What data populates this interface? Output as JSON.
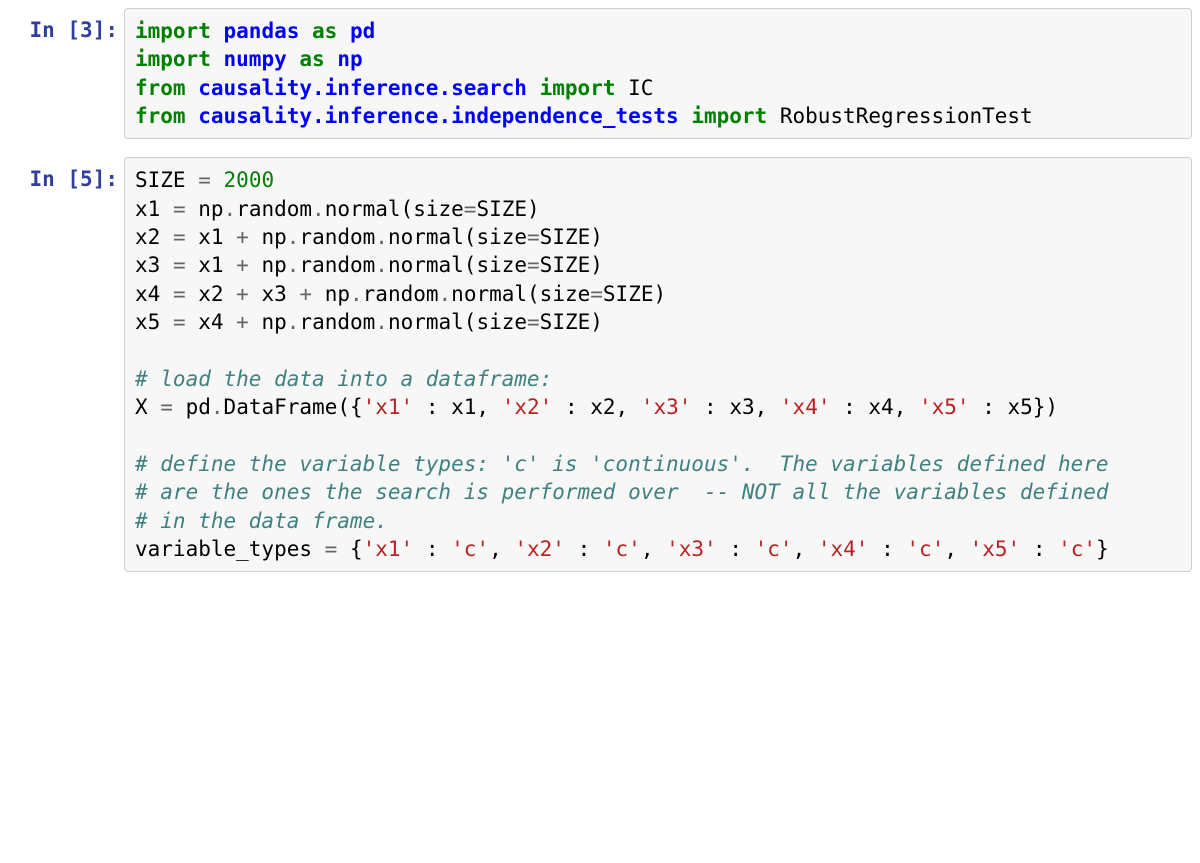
{
  "cells": [
    {
      "prompt": "In [3]:",
      "tokens": [
        {
          "t": "import",
          "c": "kw-green"
        },
        {
          "t": " "
        },
        {
          "t": "pandas",
          "c": "kw-blue"
        },
        {
          "t": " "
        },
        {
          "t": "as",
          "c": "kw-green"
        },
        {
          "t": " "
        },
        {
          "t": "pd",
          "c": "kw-blue"
        },
        {
          "t": "\n"
        },
        {
          "t": "import",
          "c": "kw-green"
        },
        {
          "t": " "
        },
        {
          "t": "numpy",
          "c": "kw-blue"
        },
        {
          "t": " "
        },
        {
          "t": "as",
          "c": "kw-green"
        },
        {
          "t": " "
        },
        {
          "t": "np",
          "c": "kw-blue"
        },
        {
          "t": "\n"
        },
        {
          "t": "from",
          "c": "kw-green"
        },
        {
          "t": " "
        },
        {
          "t": "causality.inference.search",
          "c": "kw-blue"
        },
        {
          "t": " "
        },
        {
          "t": "import",
          "c": "kw-green"
        },
        {
          "t": " IC\n"
        },
        {
          "t": "from",
          "c": "kw-green"
        },
        {
          "t": " "
        },
        {
          "t": "causality.inference.independence_tests",
          "c": "kw-blue"
        },
        {
          "t": " "
        },
        {
          "t": "import",
          "c": "kw-green"
        },
        {
          "t": " RobustRegressionTest"
        }
      ]
    },
    {
      "prompt": "In [5]:",
      "tokens": [
        {
          "t": "SIZE "
        },
        {
          "t": "=",
          "c": "op"
        },
        {
          "t": " "
        },
        {
          "t": "2000",
          "c": "num"
        },
        {
          "t": "\n"
        },
        {
          "t": "x1 "
        },
        {
          "t": "=",
          "c": "op"
        },
        {
          "t": " np"
        },
        {
          "t": ".",
          "c": "op"
        },
        {
          "t": "random"
        },
        {
          "t": ".",
          "c": "op"
        },
        {
          "t": "normal(size"
        },
        {
          "t": "=",
          "c": "op"
        },
        {
          "t": "SIZE)\n"
        },
        {
          "t": "x2 "
        },
        {
          "t": "=",
          "c": "op"
        },
        {
          "t": " x1 "
        },
        {
          "t": "+",
          "c": "op"
        },
        {
          "t": " np"
        },
        {
          "t": ".",
          "c": "op"
        },
        {
          "t": "random"
        },
        {
          "t": ".",
          "c": "op"
        },
        {
          "t": "normal(size"
        },
        {
          "t": "=",
          "c": "op"
        },
        {
          "t": "SIZE)\n"
        },
        {
          "t": "x3 "
        },
        {
          "t": "=",
          "c": "op"
        },
        {
          "t": " x1 "
        },
        {
          "t": "+",
          "c": "op"
        },
        {
          "t": " np"
        },
        {
          "t": ".",
          "c": "op"
        },
        {
          "t": "random"
        },
        {
          "t": ".",
          "c": "op"
        },
        {
          "t": "normal(size"
        },
        {
          "t": "=",
          "c": "op"
        },
        {
          "t": "SIZE)\n"
        },
        {
          "t": "x4 "
        },
        {
          "t": "=",
          "c": "op"
        },
        {
          "t": " x2 "
        },
        {
          "t": "+",
          "c": "op"
        },
        {
          "t": " x3 "
        },
        {
          "t": "+",
          "c": "op"
        },
        {
          "t": " np"
        },
        {
          "t": ".",
          "c": "op"
        },
        {
          "t": "random"
        },
        {
          "t": ".",
          "c": "op"
        },
        {
          "t": "normal(size"
        },
        {
          "t": "=",
          "c": "op"
        },
        {
          "t": "SIZE)\n"
        },
        {
          "t": "x5 "
        },
        {
          "t": "=",
          "c": "op"
        },
        {
          "t": " x4 "
        },
        {
          "t": "+",
          "c": "op"
        },
        {
          "t": " np"
        },
        {
          "t": ".",
          "c": "op"
        },
        {
          "t": "random"
        },
        {
          "t": ".",
          "c": "op"
        },
        {
          "t": "normal(size"
        },
        {
          "t": "=",
          "c": "op"
        },
        {
          "t": "SIZE)\n"
        },
        {
          "t": "\n"
        },
        {
          "t": "# load the data into a dataframe:",
          "c": "comment"
        },
        {
          "t": "\n"
        },
        {
          "t": "X "
        },
        {
          "t": "=",
          "c": "op"
        },
        {
          "t": " pd"
        },
        {
          "t": ".",
          "c": "op"
        },
        {
          "t": "DataFrame({"
        },
        {
          "t": "'x1'",
          "c": "str"
        },
        {
          "t": " : x1, "
        },
        {
          "t": "'x2'",
          "c": "str"
        },
        {
          "t": " : x2, "
        },
        {
          "t": "'x3'",
          "c": "str"
        },
        {
          "t": " : x3, "
        },
        {
          "t": "'x4'",
          "c": "str"
        },
        {
          "t": " : x4, "
        },
        {
          "t": "'x5'",
          "c": "str"
        },
        {
          "t": " : x5})\n"
        },
        {
          "t": "\n"
        },
        {
          "t": "# define the variable types: 'c' is 'continuous'.  The variables defined here",
          "c": "comment"
        },
        {
          "t": "\n"
        },
        {
          "t": "# are the ones the search is performed over  -- NOT all the variables defined",
          "c": "comment"
        },
        {
          "t": "\n"
        },
        {
          "t": "# in the data frame.",
          "c": "comment"
        },
        {
          "t": "\n"
        },
        {
          "t": "variable_types "
        },
        {
          "t": "=",
          "c": "op"
        },
        {
          "t": " {"
        },
        {
          "t": "'x1'",
          "c": "str"
        },
        {
          "t": " : "
        },
        {
          "t": "'c'",
          "c": "str"
        },
        {
          "t": ", "
        },
        {
          "t": "'x2'",
          "c": "str"
        },
        {
          "t": " : "
        },
        {
          "t": "'c'",
          "c": "str"
        },
        {
          "t": ", "
        },
        {
          "t": "'x3'",
          "c": "str"
        },
        {
          "t": " : "
        },
        {
          "t": "'c'",
          "c": "str"
        },
        {
          "t": ", "
        },
        {
          "t": "'x4'",
          "c": "str"
        },
        {
          "t": " : "
        },
        {
          "t": "'c'",
          "c": "str"
        },
        {
          "t": ", "
        },
        {
          "t": "'x5'",
          "c": "str"
        },
        {
          "t": " : "
        },
        {
          "t": "'c'",
          "c": "str"
        },
        {
          "t": "}"
        }
      ]
    }
  ]
}
